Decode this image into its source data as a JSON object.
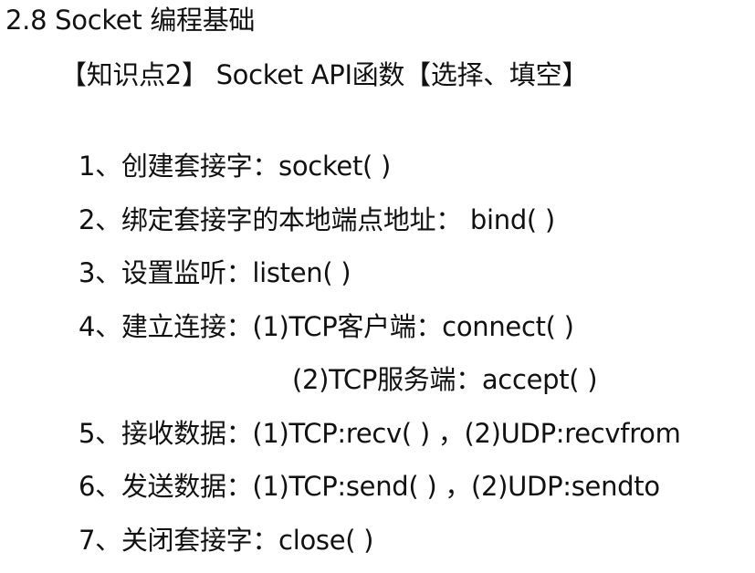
{
  "section_title": "2.8 Socket 编程基础",
  "subheading": "【知识点2】 Socket API函数【选择、填空】",
  "lines": [
    "1、创建套接字：socket( )",
    "2、绑定套接字的本地端点地址： bind( )",
    "3、设置监听：listen( )",
    "4、建立连接：(1)TCP客户端：connect( )",
    "(2)TCP服务端：accept( )",
    "5、接收数据：(1)TCP:recv( ) ，(2)UDP:recvfrom",
    "6、发送数据：(1)TCP:send( ) ，(2)UDP:sendto",
    "7、关闭套接字：close( )"
  ]
}
